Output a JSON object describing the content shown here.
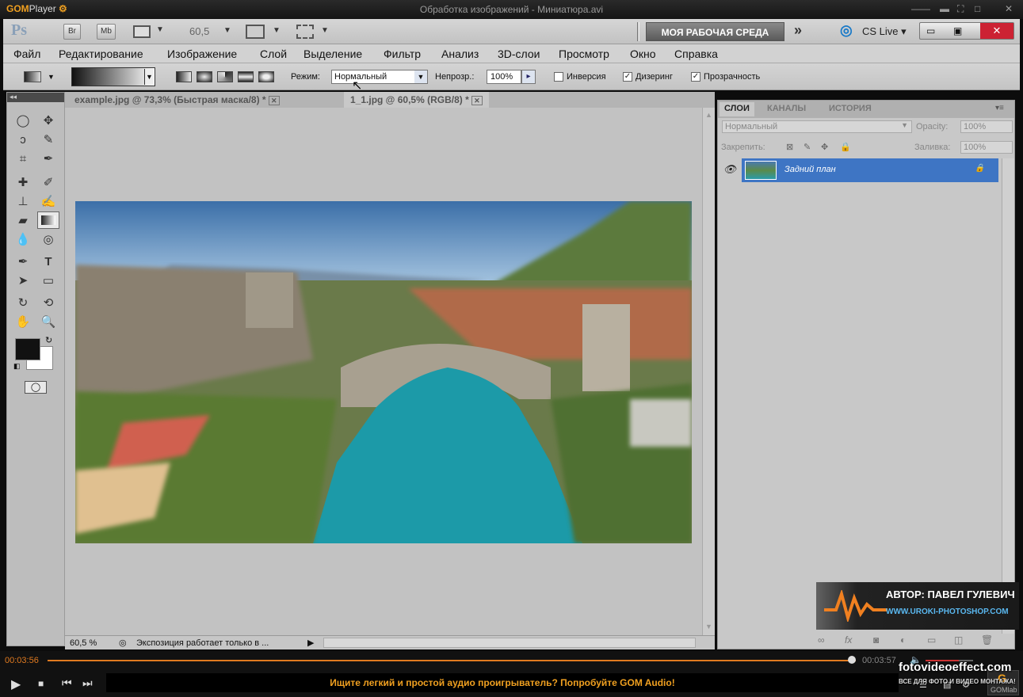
{
  "player": {
    "logo_a": "GOM",
    "logo_b": "Player",
    "title": "Обработка изображений - Миниатюра.avi",
    "time_current": "00:03:56",
    "time_total": "00:03:57",
    "seek_progress": 0.995,
    "ad_text": "Ищите легкий и простой аудио проигрыватель? Попробуйте GOM Audio!",
    "brand_label": "GOMlab"
  },
  "appbar": {
    "ps_logo": "Ps",
    "br": "Br",
    "mb": "Mb",
    "zoom": "60,5",
    "workspace": "МОЯ РАБОЧАЯ СРЕДА",
    "cslive": "CS Live"
  },
  "menu": [
    "Файл",
    "Редактирование",
    "Изображение",
    "Слой",
    "Выделение",
    "Фильтр",
    "Анализ",
    "3D-слои",
    "Просмотр",
    "Окно",
    "Справка"
  ],
  "options": {
    "mode_label": "Режим:",
    "mode_value": "Нормальный",
    "opacity_label": "Непрозр.:",
    "opacity_value": "100%",
    "inverse": "Инверсия",
    "dither": "Дизеринг",
    "transparency": "Прозрачность"
  },
  "tabs": [
    {
      "label": "example.jpg @ 73,3% (Быстрая маска/8) *"
    },
    {
      "label": "1_1.jpg @ 60,5% (RGB/8) *"
    }
  ],
  "status": {
    "zoom": "60,5 %",
    "message": "Экспозиция работает только в ..."
  },
  "panel": {
    "tabs": [
      "СЛОИ",
      "КАНАЛЫ",
      "ИСТОРИЯ"
    ],
    "blend": "Нормальный",
    "opacity_label": "Opacity:",
    "opacity_value": "100%",
    "lock_label": "Закрепить:",
    "fill_label": "Заливка:",
    "fill_value": "100%",
    "layer_name": "Задний план"
  },
  "watermark": {
    "author": "АВТОР: ПАВЕЛ ГУЛЕВИЧ",
    "url": "WWW.UROKI-PHOTOSHOP.COM",
    "site": "fotovideoeffect.com",
    "slogan": "ВСЕ ДЛЯ ФОТО И ВИДЕО МОНТАЖА!"
  },
  "colors": {
    "accent": "#f0a020",
    "selection": "#3e75c4"
  }
}
